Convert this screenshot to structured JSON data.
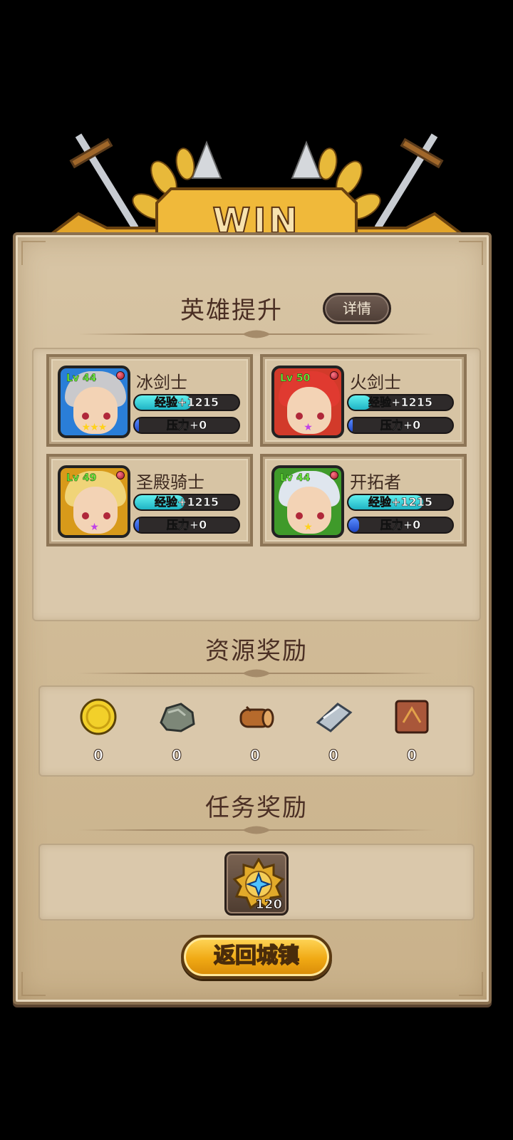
{
  "banner": {
    "title": "WIN"
  },
  "hero_section": {
    "title": "英雄提升",
    "detail_button": "详情",
    "heroes": [
      {
        "name": "冰剑士",
        "level": "Lv 44",
        "exp": "经验+1215",
        "pressure": "压力+0",
        "exp_fill_pct": 55,
        "pressure_fill_pct": 4,
        "frame_color": "#2a7ed8",
        "hair_color": "#c9c9cc",
        "stars": "★★★",
        "star_color": "#ffd21a"
      },
      {
        "name": "火剑士",
        "level": "Lv 50",
        "exp": "经验+1215",
        "pressure": "压力+0",
        "exp_fill_pct": 22,
        "pressure_fill_pct": 4,
        "frame_color": "#d23a2a",
        "hair_color": "#e03a30",
        "stars": "★",
        "star_color": "#c040e8"
      },
      {
        "name": "圣殿骑士",
        "level": "Lv 49",
        "exp": "经验+1215",
        "pressure": "压力+0",
        "exp_fill_pct": 48,
        "pressure_fill_pct": 4,
        "frame_color": "#d89a1a",
        "hair_color": "#f0d478",
        "stars": "★",
        "star_color": "#c040e8"
      },
      {
        "name": "开拓者",
        "level": "Lv 44",
        "exp": "经验+1215",
        "pressure": "压力+0",
        "exp_fill_pct": 72,
        "pressure_fill_pct": 10,
        "frame_color": "#3f9a2a",
        "hair_color": "#dfe6ee",
        "stars": "★",
        "star_color": "#ffd21a"
      }
    ]
  },
  "resource_section": {
    "title": "资源奖励",
    "items": [
      {
        "icon": "gold-coin-icon",
        "amount": "0"
      },
      {
        "icon": "stone-ore-icon",
        "amount": "0"
      },
      {
        "icon": "wood-log-icon",
        "amount": "0"
      },
      {
        "icon": "iron-ingot-icon",
        "amount": "0"
      },
      {
        "icon": "leather-hide-icon",
        "amount": "0"
      }
    ]
  },
  "task_section": {
    "title": "任务奖励",
    "reward": {
      "icon": "star-medal-icon",
      "amount": "120"
    }
  },
  "return_button": "返回城镇"
}
